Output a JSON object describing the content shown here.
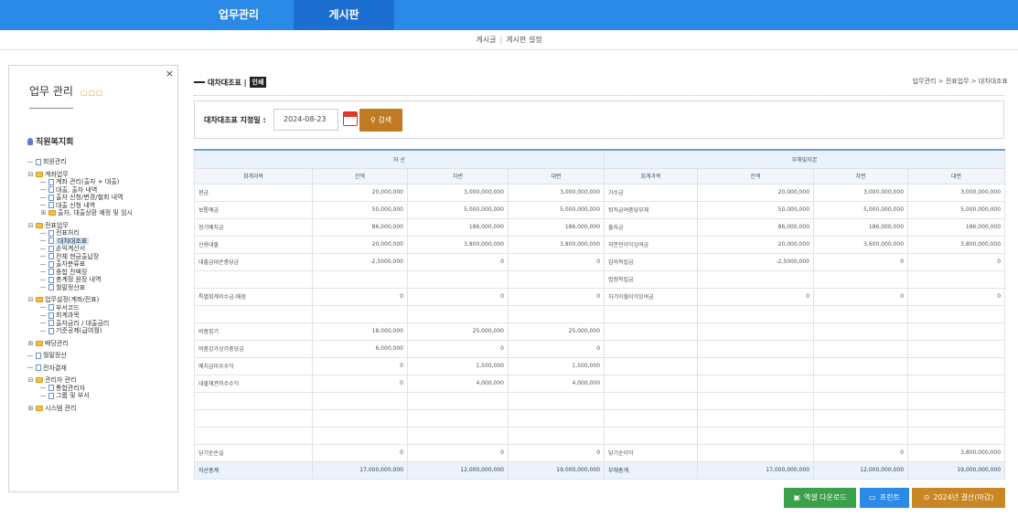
{
  "topnav": {
    "tabs": [
      {
        "label": "업무관리"
      },
      {
        "label": "게시판"
      }
    ]
  },
  "subnav": {
    "items": [
      "게시글",
      "게시판 설정"
    ],
    "sep": "|"
  },
  "sidebar": {
    "close": "×",
    "title": "업무 관리",
    "root": "직원복지회",
    "tree": [
      {
        "label": "회원관리",
        "type": "doc",
        "level": 0
      },
      {
        "gap": true
      },
      {
        "label": "계좌업무",
        "type": "folder",
        "level": 0,
        "exp": "⊟"
      },
      {
        "label": "계좌 관리(출자 + 대출)",
        "type": "doc",
        "level": 1
      },
      {
        "label": "대출, 출자 내역",
        "type": "doc",
        "level": 1
      },
      {
        "label": "출자 신청/변경/철회 내역",
        "type": "doc",
        "level": 1
      },
      {
        "label": "대출 신청 내역",
        "type": "doc",
        "level": 1
      },
      {
        "label": "출자, 대출상환 예정 및 임시",
        "type": "folder",
        "level": 1,
        "exp": "⊞"
      },
      {
        "gap": true
      },
      {
        "label": "전표업무",
        "type": "folder",
        "level": 0,
        "exp": "⊟"
      },
      {
        "label": "전표처리",
        "type": "doc",
        "level": 1
      },
      {
        "label": "대차대조표",
        "type": "doc",
        "level": 1,
        "selected": true
      },
      {
        "label": "손익계산서",
        "type": "doc",
        "level": 1
      },
      {
        "label": "전체 현금출납장",
        "type": "doc",
        "level": 1
      },
      {
        "label": "출자분류표",
        "type": "doc",
        "level": 1
      },
      {
        "label": "종합 잔액장",
        "type": "doc",
        "level": 1
      },
      {
        "label": "총계정 원장 내역",
        "type": "doc",
        "level": 1
      },
      {
        "label": "월말정산표",
        "type": "doc",
        "level": 1
      },
      {
        "gap": true
      },
      {
        "label": "업무설정(계좌/전표)",
        "type": "folder",
        "level": 0,
        "exp": "⊟"
      },
      {
        "label": "부서코드",
        "type": "doc",
        "level": 1
      },
      {
        "label": "회계과목",
        "type": "doc",
        "level": 1
      },
      {
        "label": "출자금리 / 대출금리",
        "type": "doc",
        "level": 1
      },
      {
        "label": "기준공제(급여월)",
        "type": "doc",
        "level": 1
      },
      {
        "gap": true
      },
      {
        "label": "배당관리",
        "type": "folder",
        "level": 0,
        "exp": "⊞"
      },
      {
        "gap": true
      },
      {
        "label": "월말정산",
        "type": "doc",
        "level": 0
      },
      {
        "gap": true
      },
      {
        "label": "전자결재",
        "type": "doc",
        "level": 0
      },
      {
        "gap": true
      },
      {
        "label": "관리자 관리",
        "type": "folder",
        "level": 0,
        "exp": "⊟"
      },
      {
        "label": "통합관리자",
        "type": "doc",
        "level": 1
      },
      {
        "label": "그룹 및 부서",
        "type": "doc",
        "level": 1
      },
      {
        "gap": true
      },
      {
        "label": "시스템 관리",
        "type": "folder",
        "level": 0,
        "exp": "⊞"
      }
    ]
  },
  "main": {
    "title": "대차대조표",
    "title_sep": "|",
    "print_label": "인쇄",
    "breadcrumb": "업무관리 > 전표업무 > 대차대조표",
    "search": {
      "label": "대차대조표 지정일 :",
      "date": "2024-08-23",
      "button": "검색",
      "button_icon": "⚲"
    }
  },
  "table": {
    "group_headers": [
      "자 산",
      "부채및자본"
    ],
    "col_headers": [
      "회계과목",
      "잔액",
      "차변",
      "대변",
      "회계과목",
      "잔액",
      "차변",
      "대변"
    ],
    "rows": [
      [
        "현금",
        "20,000,000",
        "3,000,000,000",
        "3,000,000,000",
        "가수금",
        "20,000,000",
        "3,000,000,000",
        "3,000,000,000"
      ],
      [
        "보통예금",
        "50,000,000",
        "5,000,000,000",
        "5,000,000,000",
        "퇴직급여충당부채",
        "50,000,000",
        "5,000,000,000",
        "5,000,000,000"
      ],
      [
        "정기예치금",
        "86,000,000",
        "186,000,000",
        "186,000,000",
        "출자금",
        "86,000,000",
        "186,000,000",
        "186,000,000"
      ],
      [
        "신용대출",
        "20,000,000",
        "3,800,000,000",
        "3,800,000,000",
        "처분전이익잉여금",
        "20,000,000",
        "3,600,000,000",
        "3,800,000,000"
      ],
      [
        "대출금대손충당금",
        "-2,5000,000",
        "0",
        "0",
        "임의적립금",
        "-2,5000,000",
        "0",
        "0"
      ],
      [
        "",
        "",
        "",
        "",
        "법정적립금",
        "",
        "",
        ""
      ],
      [
        "특별회계미수금-매점",
        "0",
        "0",
        "0",
        "차기이월이익잉여금",
        "0",
        "0",
        "0"
      ],
      [
        "",
        "",
        "",
        "",
        "",
        "",
        "",
        ""
      ],
      [
        "비품집기",
        "18,000,000",
        "25,000,000",
        "25,000,000",
        "",
        "",
        "",
        ""
      ],
      [
        "비품감가상각충당금",
        "6,000,000",
        "0",
        "0",
        "",
        "",
        "",
        ""
      ],
      [
        "예치금미수수익",
        "0",
        "1,500,000",
        "1,500,000",
        "",
        "",
        "",
        ""
      ],
      [
        "대출채권미수수익",
        "0",
        "4,000,000",
        "4,000,000",
        "",
        "",
        "",
        ""
      ],
      [
        "",
        "",
        "",
        "",
        "",
        "",
        "",
        ""
      ],
      [
        "",
        "",
        "",
        "",
        "",
        "",
        "",
        ""
      ],
      [
        "",
        "",
        "",
        "",
        "",
        "",
        "",
        ""
      ],
      [
        "당기순손실",
        "0",
        "0",
        "0",
        "당기순이익",
        "",
        "0",
        "3,800,000,000"
      ]
    ],
    "totals": [
      "자산총계",
      "17,000,000,000",
      "12,000,000,000",
      "19,000,000,000",
      "부채총계",
      "17,000,000,000",
      "12,000,000,000",
      "19,000,000,000"
    ]
  },
  "buttons": {
    "excel": {
      "label": "엑셀 다운로드",
      "icon": "▣",
      "color": "#3aa04a"
    },
    "print": {
      "label": "프린트",
      "icon": "▭",
      "color": "#2b8ae8"
    },
    "settle": {
      "label": "2024년 결산(마감)",
      "icon": "⊙",
      "color": "#c98623"
    }
  }
}
